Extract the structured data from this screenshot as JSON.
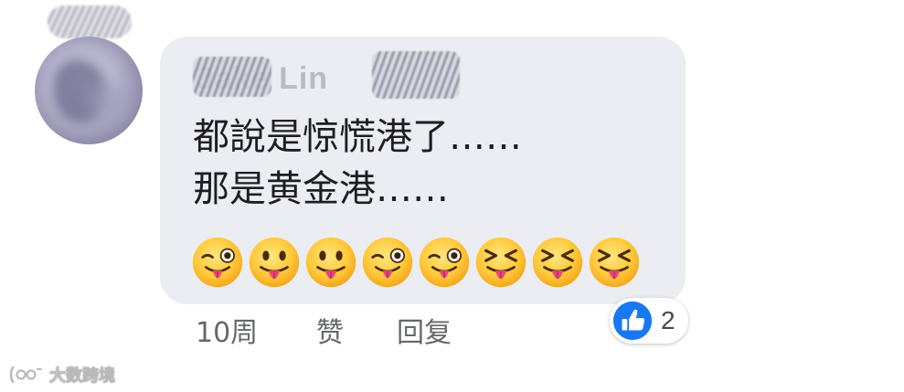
{
  "comment": {
    "author": "Jake Lin",
    "lines": [
      "都說是惊慌港了……",
      "那是黄金港……"
    ],
    "emojis": [
      "winking-tongue-face",
      "tongue-face",
      "tongue-face",
      "winking-tongue-face",
      "winking-tongue-face",
      "squinting-tongue-face",
      "squinting-tongue-face",
      "squinting-tongue-face"
    ]
  },
  "reaction": {
    "icon": "thumbs-up-icon",
    "count": "2",
    "color": "#1877f2"
  },
  "actions": {
    "time": "10周",
    "like": "赞",
    "reply": "回复"
  },
  "watermark": {
    "text": "大数跨境"
  },
  "colors": {
    "bubble": "#ecedf2",
    "text": "#1c1e21",
    "meta": "#65676b"
  }
}
